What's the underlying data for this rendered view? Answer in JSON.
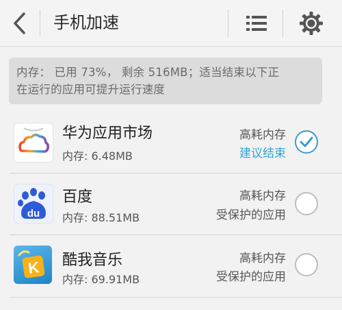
{
  "header": {
    "title": "手机加速"
  },
  "banner": {
    "line1": "内存： 已用 73%， 剩余 516MB；适当结束以下正",
    "line2": "在运行的应用可提升运行速度"
  },
  "apps": [
    {
      "name": "华为应用市场",
      "memory": "内存: 6.48MB",
      "status_top": "高耗内存",
      "status_bottom": "建议结束",
      "checked": true,
      "icon": "huawei-appmarket-icon"
    },
    {
      "name": "百度",
      "memory": "内存: 88.51MB",
      "status_top": "高耗内存",
      "status_bottom": "受保护的应用",
      "checked": false,
      "icon": "baidu-icon"
    },
    {
      "name": "酷我音乐",
      "memory": "内存: 69.91MB",
      "status_top": "高耗内存",
      "status_bottom": "受保护的应用",
      "checked": false,
      "icon": "kuwo-music-icon"
    }
  ],
  "colors": {
    "accent": "#2da6d8",
    "check_blue": "#3c9ad0"
  }
}
